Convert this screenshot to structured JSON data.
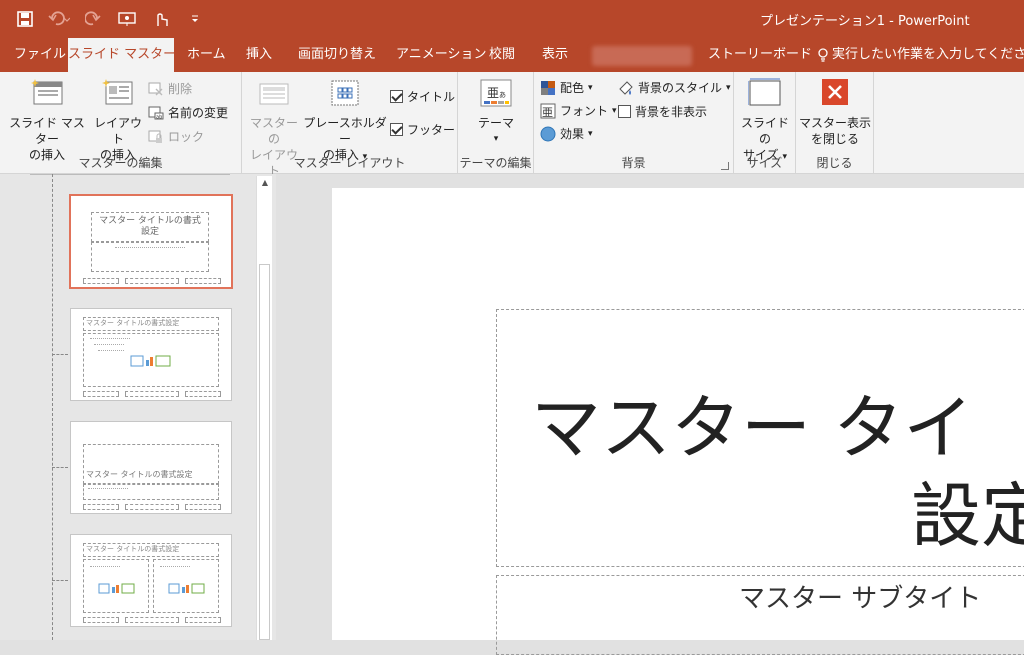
{
  "window": {
    "title": "プレゼンテーション1 - PowerPoint"
  },
  "qat": [
    {
      "icon": "save-icon"
    },
    {
      "icon": "undo-icon"
    },
    {
      "icon": "redo-icon"
    },
    {
      "icon": "present-icon"
    },
    {
      "icon": "touch-mode-icon"
    },
    {
      "icon": "customize-qat-icon"
    }
  ],
  "tabs": {
    "file": "ファイル",
    "slide_master": "スライド マスター",
    "home": "ホーム",
    "insert": "挿入",
    "transitions": "画面切り替え",
    "animations": "アニメーション",
    "review": "校閲",
    "view": "表示",
    "storyboard": "ストーリーボード",
    "tell_me": "実行したい作業を入力してください"
  },
  "ribbon": {
    "edit_master": {
      "label": "マスターの編集",
      "insert_master_1": "スライド マスター",
      "insert_master_2": "の挿入",
      "insert_layout_1": "レイアウト",
      "insert_layout_2": "の挿入",
      "delete": "削除",
      "rename": "名前の変更",
      "preserve": "ロック"
    },
    "master_layout": {
      "label": "マスター レイアウト",
      "master_layout_1": "マスターの",
      "master_layout_2": "レイアウト",
      "placeholder_1": "プレースホルダー",
      "placeholder_2": "の挿入",
      "title_cb": "タイトル",
      "footer_cb": "フッター"
    },
    "edit_theme": {
      "label": "テーマの編集",
      "themes": "テーマ"
    },
    "background": {
      "label": "背景",
      "colors": "配色",
      "fonts": "フォント",
      "effects": "効果",
      "bg_styles": "背景のスタイル",
      "hide_bg": "背景を非表示"
    },
    "size": {
      "label": "サイズ",
      "slide_size_1": "スライドの",
      "slide_size_2": "サイズ"
    },
    "close": {
      "label": "閉じる",
      "close_1": "マスター表示",
      "close_2": "を閉じる"
    }
  },
  "thumbs": {
    "t1_title_1": "マスター タイトルの書式",
    "t1_title_2": "設定",
    "t2_title": "マスター タイトルの書式設定",
    "t3_title": "マスター タイトルの書式設定",
    "t4_title": "マスター タイトルの書式設定"
  },
  "slide": {
    "title_1": "マスター タイ",
    "title_2": "設定",
    "subtitle": "マスター サブタイト"
  }
}
